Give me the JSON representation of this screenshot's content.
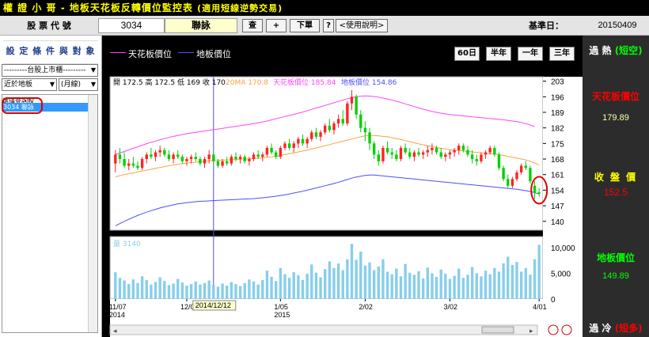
{
  "app": {
    "title": "權 證 小 哥 -  地板天花板反轉價位監控表",
    "subtitle": "(適用短線逆勢交易)"
  },
  "stock_row": {
    "code_label": "股 票 代 號",
    "code": "3034",
    "name": "聯詠",
    "btn_query": "查",
    "btn_add": "+",
    "btn_list": "下單",
    "btn_help_q": "?",
    "btn_help": "<使用說明>",
    "date_label": "基準日：",
    "date_value": "20150409"
  },
  "left_panel": {
    "header": "設 定 條 件 與 對 象",
    "market_select": "---------台股上市櫃---------",
    "sort_select": "近於地板",
    "range_select": "(月線)",
    "list": [
      {
        "label": "選擇查詢股"
      },
      {
        "label": "3034 聯詠"
      }
    ]
  },
  "legend": {
    "ceiling": "天花板價位",
    "floor": "地板價位",
    "ceiling_color": "#ff44ff",
    "floor_color": "#4d4dff"
  },
  "period_buttons": [
    "60日",
    "半年",
    "一年",
    "三年"
  ],
  "info": {
    "ohlc": "開 172.5  高 172.5  低 169  收 170",
    "ma20": "20MA 170.8",
    "ceiling": "天花板價位 185.84",
    "floor": "地板價位 154.86",
    "volume": "量 3140"
  },
  "right_panel": {
    "overheat": "過 熱",
    "overheat_tag": "(短空)",
    "ceiling_label": "天花板價位",
    "ceiling_value": "179.89",
    "close_label": "收 盤 價",
    "close_value": "152.5",
    "floor_label": "地板價位",
    "floor_value": "149.89",
    "cold": "過 冷",
    "cold_tag": "(短多)"
  },
  "colors": {
    "up": "#ff2222",
    "down": "#00d000",
    "ma20": "#ffa040",
    "ceiling": "#ff44ff",
    "floor": "#4d4dff",
    "volume": "#87ceeb",
    "highlight": "#e00000"
  },
  "chart_data": {
    "type": "candlestick",
    "ylim": [
      136,
      205
    ],
    "yticks": [
      140,
      147,
      154,
      161,
      168,
      175,
      182,
      189,
      196,
      203
    ],
    "volume_ticks": [
      "0",
      "5,000",
      "10,000"
    ],
    "volume_max": 11500,
    "x_labels": [
      "11/07\n2014",
      "12/01",
      "1/05\n2015",
      "2/02",
      "3/02",
      "4/01"
    ],
    "x_label_index": [
      0,
      16,
      37,
      56,
      75,
      95
    ],
    "crosshair_index": 22,
    "crosshair_label": "2014/12/12",
    "candles": [
      [
        166,
        172,
        162,
        170
      ],
      [
        170,
        173,
        166,
        168
      ],
      [
        168,
        171,
        164,
        165
      ],
      [
        165,
        168,
        163,
        166
      ],
      [
        166,
        169,
        164,
        165
      ],
      [
        165,
        167,
        163,
        164
      ],
      [
        164,
        169,
        163,
        168
      ],
      [
        168,
        171,
        166,
        170
      ],
      [
        170,
        173,
        168,
        169
      ],
      [
        169,
        172,
        167,
        171
      ],
      [
        171,
        174,
        169,
        172
      ],
      [
        172,
        173,
        169,
        170
      ],
      [
        170,
        172,
        167,
        168
      ],
      [
        168,
        171,
        166,
        170
      ],
      [
        170,
        172,
        168,
        169
      ],
      [
        169,
        170,
        166,
        167
      ],
      [
        167,
        169,
        165,
        168
      ],
      [
        168,
        170,
        166,
        169
      ],
      [
        169,
        171,
        167,
        168
      ],
      [
        168,
        169,
        165,
        166
      ],
      [
        166,
        169,
        164,
        168
      ],
      [
        168,
        172,
        166,
        170
      ],
      [
        170,
        171,
        166,
        167
      ],
      [
        167,
        168,
        164,
        165
      ],
      [
        165,
        168,
        164,
        167
      ],
      [
        167,
        169,
        165,
        166
      ],
      [
        166,
        170,
        165,
        169
      ],
      [
        169,
        171,
        167,
        168
      ],
      [
        168,
        170,
        166,
        169
      ],
      [
        169,
        170,
        166,
        167
      ],
      [
        167,
        169,
        165,
        168
      ],
      [
        168,
        171,
        167,
        170
      ],
      [
        170,
        172,
        168,
        169
      ],
      [
        169,
        171,
        167,
        170
      ],
      [
        170,
        174,
        169,
        173
      ],
      [
        173,
        175,
        170,
        171
      ],
      [
        171,
        172,
        168,
        169
      ],
      [
        169,
        174,
        168,
        173
      ],
      [
        173,
        176,
        172,
        175
      ],
      [
        175,
        177,
        172,
        173
      ],
      [
        173,
        176,
        171,
        175
      ],
      [
        175,
        178,
        173,
        177
      ],
      [
        177,
        179,
        174,
        175
      ],
      [
        175,
        178,
        173,
        177
      ],
      [
        177,
        181,
        176,
        180
      ],
      [
        180,
        182,
        177,
        178
      ],
      [
        178,
        181,
        176,
        180
      ],
      [
        180,
        184,
        179,
        183
      ],
      [
        183,
        186,
        180,
        181
      ],
      [
        181,
        185,
        179,
        184
      ],
      [
        184,
        188,
        182,
        186
      ],
      [
        186,
        190,
        183,
        184
      ],
      [
        184,
        194,
        183,
        193
      ],
      [
        193,
        199,
        190,
        196
      ],
      [
        196,
        197,
        186,
        188
      ],
      [
        188,
        190,
        180,
        182
      ],
      [
        182,
        185,
        176,
        180
      ],
      [
        180,
        182,
        172,
        175
      ],
      [
        175,
        176,
        168,
        170
      ],
      [
        170,
        172,
        165,
        167
      ],
      [
        167,
        174,
        166,
        173
      ],
      [
        173,
        176,
        170,
        171
      ],
      [
        171,
        173,
        168,
        170
      ],
      [
        170,
        172,
        167,
        168
      ],
      [
        168,
        174,
        167,
        173
      ],
      [
        173,
        175,
        170,
        171
      ],
      [
        171,
        173,
        168,
        169
      ],
      [
        169,
        172,
        167,
        171
      ],
      [
        171,
        173,
        169,
        170
      ],
      [
        170,
        172,
        168,
        171
      ],
      [
        171,
        174,
        169,
        172
      ],
      [
        172,
        175,
        170,
        173
      ],
      [
        173,
        174,
        170,
        171
      ],
      [
        171,
        173,
        168,
        169
      ],
      [
        169,
        171,
        167,
        170
      ],
      [
        170,
        172,
        168,
        171
      ],
      [
        171,
        173,
        169,
        172
      ],
      [
        172,
        175,
        170,
        174
      ],
      [
        174,
        175,
        171,
        172
      ],
      [
        172,
        174,
        169,
        170
      ],
      [
        170,
        172,
        166,
        168
      ],
      [
        168,
        170,
        165,
        167
      ],
      [
        167,
        171,
        166,
        170
      ],
      [
        170,
        172,
        168,
        171
      ],
      [
        171,
        174,
        170,
        173
      ],
      [
        173,
        174,
        169,
        170
      ],
      [
        170,
        171,
        163,
        164
      ],
      [
        164,
        165,
        158,
        159
      ],
      [
        159,
        161,
        155,
        156
      ],
      [
        156,
        160,
        155,
        159
      ],
      [
        159,
        163,
        158,
        162
      ],
      [
        162,
        166,
        161,
        165
      ],
      [
        165,
        167,
        163,
        164
      ],
      [
        164,
        165,
        157,
        158
      ],
      [
        156,
        158,
        150,
        153
      ],
      [
        153,
        155,
        151,
        152.5
      ]
    ],
    "ma20": [
      160,
      160.5,
      161,
      161.4,
      161.8,
      162.2,
      162.6,
      163,
      163.4,
      163.8,
      164.2,
      164.6,
      165,
      165.3,
      165.6,
      165.9,
      166.2,
      166.4,
      166.6,
      166.8,
      167,
      167.2,
      167.3,
      167.4,
      167.5,
      167.6,
      167.7,
      167.8,
      167.9,
      168,
      168.1,
      168.2,
      168.4,
      168.6,
      168.8,
      169,
      169.3,
      169.6,
      170,
      170.4,
      170.8,
      171.2,
      171.6,
      172,
      172.5,
      173,
      173.5,
      174,
      174.5,
      175,
      175.5,
      176,
      176.5,
      177,
      177.5,
      178,
      178.4,
      178.6,
      178.6,
      178.4,
      178.2,
      178,
      177.6,
      177.2,
      176.8,
      176.3,
      175.8,
      175.3,
      174.8,
      174.4,
      174,
      173.6,
      173.2,
      172.8,
      172.5,
      172.2,
      172,
      171.8,
      171.6,
      171.4,
      171.2,
      171,
      170.8,
      170.6,
      170.4,
      170.2,
      170,
      169.6,
      169.2,
      168.8,
      168.4,
      168,
      167.6,
      167,
      166.2,
      165.4
    ],
    "ceiling": [
      170,
      170.7,
      171.4,
      172.1,
      172.8,
      173.5,
      174.2,
      174.9,
      175.5,
      176.1,
      176.7,
      177.2,
      177.7,
      178.2,
      178.6,
      179,
      179.4,
      179.7,
      180,
      180.3,
      180.6,
      180.9,
      181.2,
      181.5,
      181.8,
      182.1,
      182.4,
      182.7,
      183,
      183.3,
      183.6,
      183.9,
      184.3,
      184.7,
      185.1,
      185.6,
      186.1,
      186.6,
      187.1,
      187.6,
      188.1,
      188.6,
      189.1,
      189.7,
      190.3,
      190.9,
      191.5,
      192.1,
      192.7,
      193.3,
      193.9,
      194.5,
      195.1,
      195.6,
      196,
      196.3,
      196.4,
      196.3,
      196.1,
      195.8,
      195.4,
      195,
      194.5,
      194,
      193.4,
      192.8,
      192.2,
      191.6,
      191,
      190.4,
      189.9,
      189.4,
      189,
      188.6,
      188.3,
      188,
      187.8,
      187.6,
      187.4,
      187.2,
      187,
      186.8,
      186.6,
      186.4,
      186.2,
      186,
      185.8,
      185.6,
      185.4,
      185.1,
      184.8,
      184.4,
      183.9,
      183.3,
      182.6
    ],
    "floor": [
      138,
      139,
      140,
      140.9,
      141.8,
      142.6,
      143.4,
      144.1,
      144.8,
      145.4,
      146,
      146.5,
      147,
      147.4,
      147.8,
      148.1,
      148.4,
      148.6,
      148.8,
      149,
      149.1,
      149.2,
      149.3,
      149.4,
      149.5,
      149.6,
      149.7,
      149.8,
      149.9,
      150,
      150.1,
      150.2,
      150.4,
      150.6,
      150.8,
      151,
      151.3,
      151.6,
      151.9,
      152.3,
      152.7,
      153.1,
      153.5,
      154,
      154.5,
      155,
      155.5,
      156,
      156.5,
      157,
      157.6,
      158.2,
      158.8,
      159.4,
      159.9,
      160.3,
      160.6,
      160.8,
      160.8,
      160.6,
      160.4,
      160.2,
      160,
      159.8,
      159.6,
      159.4,
      159.2,
      159,
      158.8,
      158.6,
      158.4,
      158.2,
      158,
      157.8,
      157.6,
      157.4,
      157.2,
      157,
      156.8,
      156.6,
      156.4,
      156.2,
      156,
      155.8,
      155.6,
      155.4,
      155.2,
      155,
      154.8,
      154.6,
      154.4,
      154.1,
      153.8,
      153.4,
      152.9,
      152.3
    ],
    "volume": [
      5200,
      4100,
      3600,
      2900,
      3800,
      3100,
      4400,
      3700,
      2800,
      3300,
      4200,
      3500,
      2700,
      3000,
      3900,
      3200,
      2600,
      2900,
      3400,
      2800,
      3100,
      3600,
      2700,
      2400,
      3000,
      2600,
      3300,
      2900,
      2500,
      3100,
      3800,
      3400,
      2800,
      3700,
      5500,
      4300,
      3500,
      6000,
      4800,
      4100,
      5200,
      4600,
      3700,
      4900,
      6700,
      5100,
      4200,
      5800,
      7300,
      6000,
      6900,
      5600,
      7700,
      10700,
      7600,
      9200,
      6500,
      7100,
      5600,
      6300,
      7700,
      5300,
      4800,
      5900,
      4400,
      6800,
      5100,
      4700,
      5400,
      4000,
      6100,
      5000,
      4300,
      5700,
      4900,
      3900,
      4500,
      5900,
      4100,
      4700,
      6200,
      5000,
      4400,
      5500,
      4800,
      6000,
      5300,
      6900,
      8200,
      6600,
      7200,
      5300,
      6000,
      4700,
      7700,
      10500
    ]
  }
}
